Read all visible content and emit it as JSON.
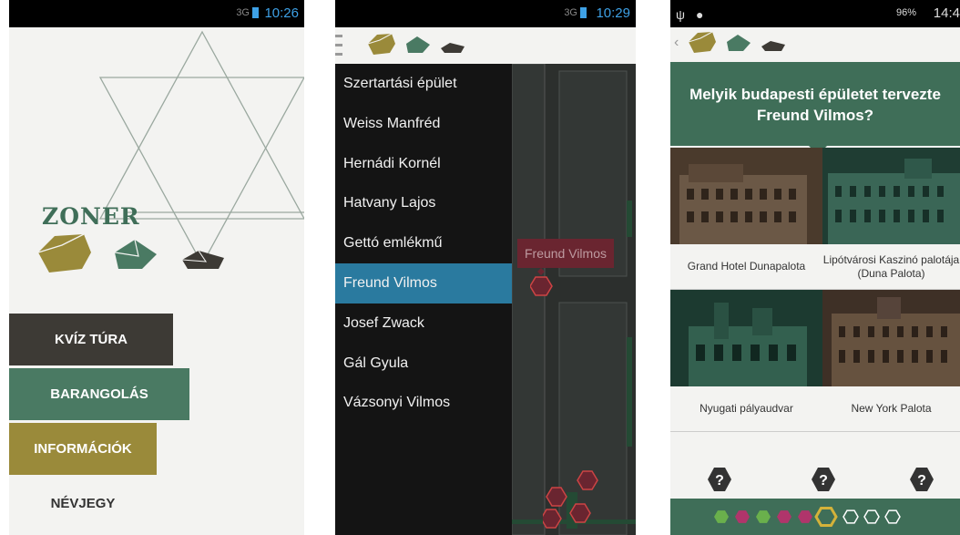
{
  "screen1": {
    "status_time": "10:26",
    "status_signal": "3G",
    "logo_text": "ZONER",
    "menu": [
      {
        "label": "KVÍZ TÚRA",
        "color": "#3d3a35"
      },
      {
        "label": "BARANGOLÁS",
        "color": "#4a7a63"
      },
      {
        "label": "INFORMÁCIÓK",
        "color": "#9a8a3a"
      },
      {
        "label": "NÉVJEGY",
        "color": "transparent"
      }
    ]
  },
  "screen2": {
    "status_time": "10:29",
    "status_signal": "3G",
    "menu_icon": "hamburger-icon",
    "drawer_items": [
      "Szertartási épület",
      "Weiss Manfréd",
      "Hernádi Kornél",
      "Hatvany Lajos",
      "Gettó emlékmű",
      "Freund Vilmos",
      "Josef Zwack",
      "Gál Gyula",
      "Vázsonyi Vilmos"
    ],
    "active_item": "Freund Vilmos",
    "map_tag": "Freund Vilmos"
  },
  "screen3": {
    "status_time": "14:4",
    "status_battery": "96%",
    "question": "Melyik budapesti épületet tervezte Freund Vilmos?",
    "answers": [
      "Grand Hotel Dunapalota",
      "Lipótvárosi Kaszinó palotája (Duna Palota)",
      "Nyugati pályaudvar",
      "New York Palota"
    ],
    "hint_icons": [
      "?",
      "?",
      "?"
    ],
    "progress_colors": [
      "#6ab04c",
      "#b0356b",
      "#6ab04c",
      "#b0356b",
      "#b0356b",
      "current",
      "empty",
      "empty",
      "empty"
    ]
  },
  "colors": {
    "green": "#3f6e58",
    "gold": "#9a8a3a",
    "dark": "#3d3a35",
    "blue": "#2a7a9f"
  }
}
